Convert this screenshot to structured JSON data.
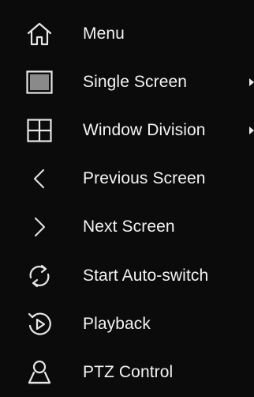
{
  "menu": {
    "items": [
      {
        "key": "menu",
        "label": "Menu",
        "icon": "home-icon",
        "has_submenu": false
      },
      {
        "key": "single-screen",
        "label": "Single Screen",
        "icon": "single-screen-icon",
        "has_submenu": true
      },
      {
        "key": "window-division",
        "label": "Window Division",
        "icon": "grid-icon",
        "has_submenu": true
      },
      {
        "key": "previous-screen",
        "label": "Previous Screen",
        "icon": "chevron-left-icon",
        "has_submenu": false
      },
      {
        "key": "next-screen",
        "label": "Next Screen",
        "icon": "chevron-right-icon",
        "has_submenu": false
      },
      {
        "key": "start-auto-switch",
        "label": "Start Auto-switch",
        "icon": "refresh-icon",
        "has_submenu": false
      },
      {
        "key": "playback",
        "label": "Playback",
        "icon": "playback-icon",
        "has_submenu": false
      },
      {
        "key": "ptz-control",
        "label": "PTZ Control",
        "icon": "ptz-camera-icon",
        "has_submenu": false
      }
    ]
  },
  "colors": {
    "background": "#0b0b0b",
    "text": "#f3f3f3",
    "icon": "#e6e6e6"
  }
}
